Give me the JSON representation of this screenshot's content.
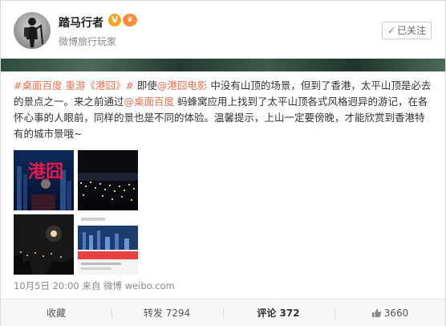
{
  "user": {
    "name": "踏马行者",
    "description": "微博旅行玩家",
    "verified_icon": "verified-v-icon",
    "vip_icon": "vip-icon",
    "follow_label": "已关注",
    "follow_check": "✓"
  },
  "post": {
    "segments": [
      {
        "text": "#桌面百度 重游《港囧》#",
        "type": "hashtag"
      },
      {
        "text": " 即使",
        "type": "plain"
      },
      {
        "text": "@港囧电影",
        "type": "mention"
      },
      {
        "text": " 中没有山顶的场景，但到了香港，太平山顶是必去的景点之一。来之前通过",
        "type": "plain"
      },
      {
        "text": "@桌面百度",
        "type": "mention"
      },
      {
        "text": " 蚂蜂窝应用上找到了太平山顶各式风格迥异的游记，在各怀心事的人眼前，同样的景也是不同的体验。温馨提示，上山一定要傍晚，才能欣赏到香港特有的城市景哦~",
        "type": "plain"
      }
    ],
    "images": [
      {
        "name": "photo-gangjiong-poster",
        "poster_text": "港囧"
      },
      {
        "name": "photo-night-city"
      },
      {
        "name": "photo-peak-moon"
      },
      {
        "name": "photo-app-screenshot"
      }
    ],
    "meta": "10月5日 20:00 来自 微博 weibo.com"
  },
  "actions": {
    "favorite": "收藏",
    "repost": "转发 7294",
    "comment": "评论 372",
    "like": "3660"
  },
  "colors": {
    "link": "#eb7350",
    "text": "#333333",
    "muted": "#888888"
  }
}
